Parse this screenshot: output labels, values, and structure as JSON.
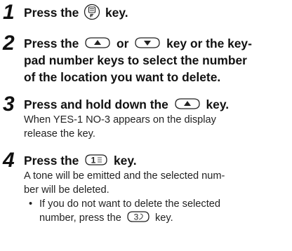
{
  "steps": [
    {
      "number": "1",
      "head_before": "Press the",
      "key_icon": "phonebook-key-icon",
      "head_after": "key."
    },
    {
      "number": "2",
      "line1_before": "Press the",
      "key_a_icon": "up-arrow-key-icon",
      "line1_mid": "or",
      "key_b_icon": "down-arrow-key-icon",
      "line1_after": "key or the key-",
      "line2": "pad number keys to select the number",
      "line3": "of the location you want to delete."
    },
    {
      "number": "3",
      "head_before": "Press and hold down the",
      "key_icon": "up-arrow-key-icon",
      "head_after": "key.",
      "desc1": "When YES-1 NO-3 appears on the display",
      "desc2": "release the key."
    },
    {
      "number": "4",
      "head_before": "Press the",
      "key_icon": "key-1-icon",
      "head_after": "key.",
      "desc1": "A tone will be emitted and the selected num-",
      "desc2": "ber will be deleted.",
      "bullet_line1": "If you do not want to delete the selected",
      "bullet_before": "number, press the",
      "bullet_key_icon": "key-3-icon",
      "bullet_after": "key."
    }
  ],
  "key_labels": {
    "one": "1",
    "three": "3"
  }
}
